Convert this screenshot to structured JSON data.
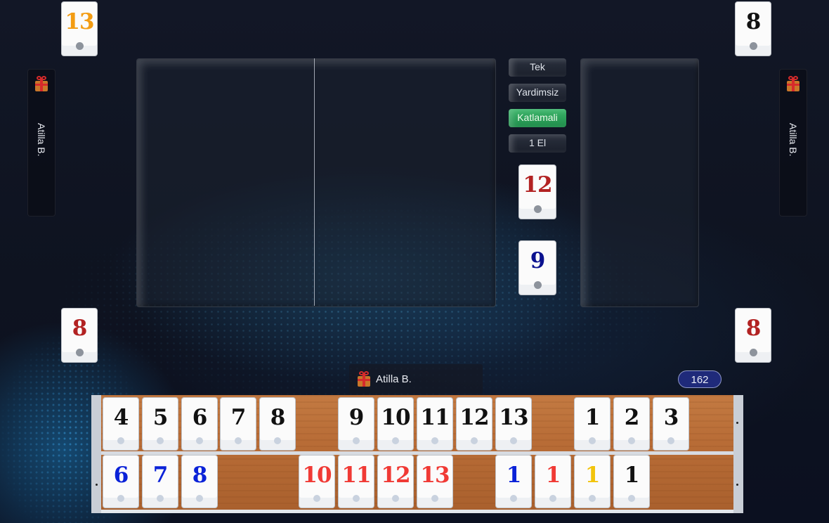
{
  "corner_tiles": {
    "top_left": {
      "value": "13",
      "color": "orange"
    },
    "top_right": {
      "value": "8",
      "color": "black"
    },
    "bottom_left": {
      "value": "8",
      "color": "red"
    },
    "bottom_right": {
      "value": "8",
      "color": "red"
    }
  },
  "players": {
    "left_name": "Atilla B.",
    "right_name": "Atilla B.",
    "me_name": "Atilla B."
  },
  "game_options": [
    {
      "label": "Tek",
      "active": false
    },
    {
      "label": "Yardimsiz",
      "active": false
    },
    {
      "label": "Katlamali",
      "active": true
    },
    {
      "label": "1 El",
      "active": false
    }
  ],
  "center_tiles": {
    "okey_indicator": {
      "value": "12",
      "color": "red"
    },
    "draw_tile": {
      "value": "9",
      "color": "darkblue"
    }
  },
  "score": "162",
  "rack": {
    "top_row": [
      {
        "value": "4",
        "color": "black"
      },
      {
        "value": "5",
        "color": "black"
      },
      {
        "value": "6",
        "color": "black"
      },
      {
        "value": "7",
        "color": "black"
      },
      {
        "value": "8",
        "color": "black"
      },
      {
        "value": "9",
        "color": "black"
      },
      {
        "value": "10",
        "color": "black"
      },
      {
        "value": "11",
        "color": "black"
      },
      {
        "value": "12",
        "color": "black"
      },
      {
        "value": "13",
        "color": "black"
      },
      {
        "value": "1",
        "color": "black"
      },
      {
        "value": "2",
        "color": "black"
      },
      {
        "value": "3",
        "color": "black"
      }
    ],
    "bottom_row": [
      {
        "value": "6",
        "color": "blue"
      },
      {
        "value": "7",
        "color": "blue"
      },
      {
        "value": "8",
        "color": "blue"
      },
      {
        "value": "10",
        "color": "red"
      },
      {
        "value": "11",
        "color": "red"
      },
      {
        "value": "12",
        "color": "red"
      },
      {
        "value": "13",
        "color": "red"
      },
      {
        "value": "1",
        "color": "blue"
      },
      {
        "value": "1",
        "color": "red"
      },
      {
        "value": "1",
        "color": "yellow"
      },
      {
        "value": "1",
        "color": "black"
      }
    ]
  },
  "colors": {
    "accent_green": "#2ea85c",
    "score_badge": "#1f2a7a",
    "tile_orange": "#f39c12",
    "tile_red": "#b22222",
    "tile_bright_red": "#f03a35",
    "tile_blue": "#0a22d8",
    "tile_darkblue": "#0b128f",
    "tile_yellow": "#f2c40c",
    "tile_black": "#111111"
  },
  "icons": {
    "player_gift": "gift-icon"
  }
}
